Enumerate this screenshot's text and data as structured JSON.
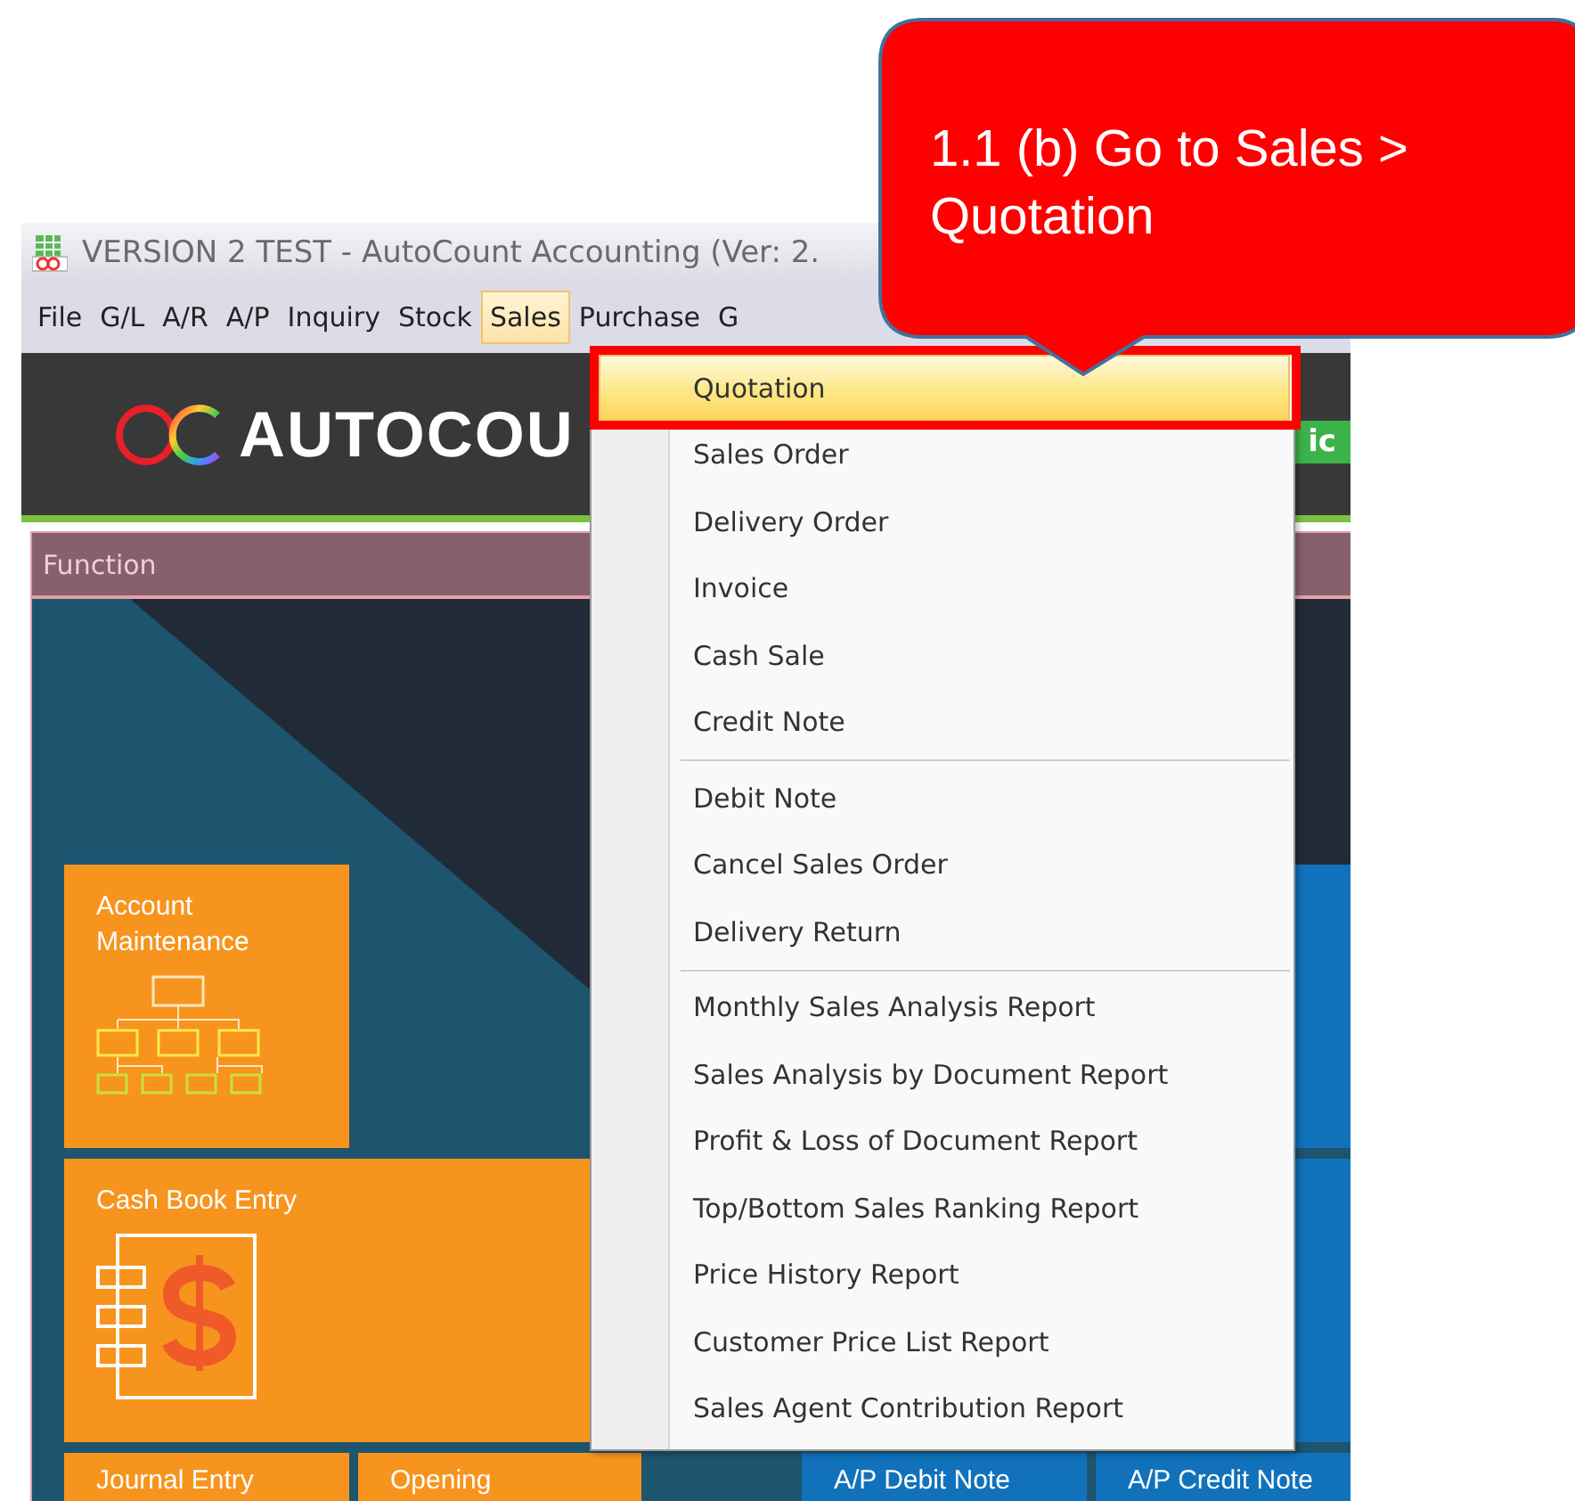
{
  "window": {
    "title": "VERSION 2 TEST - AutoCount Accounting (Ver: 2."
  },
  "menu_bar": [
    {
      "label": "File",
      "selected": false
    },
    {
      "label": "G/L",
      "selected": false
    },
    {
      "label": "A/R",
      "selected": false
    },
    {
      "label": "A/P",
      "selected": false
    },
    {
      "label": "Inquiry",
      "selected": false
    },
    {
      "label": "Stock",
      "selected": false
    },
    {
      "label": "Sales",
      "selected": true
    },
    {
      "label": "Purchase",
      "selected": false
    },
    {
      "label": "G",
      "selected": false
    }
  ],
  "banner": {
    "logo_text": "AUTOCOU",
    "badge": "ic"
  },
  "panel": {
    "title": "Function"
  },
  "tile_rows": [
    [
      {
        "label": "Account Maintenance",
        "kind": "orange"
      },
      {
        "kind": "blue"
      }
    ],
    [
      {
        "label": "Cash Book Entry",
        "kind": "orange"
      },
      {
        "kind": "blue"
      }
    ],
    [
      {
        "label": "Journal Entry",
        "kind": "orange"
      },
      {
        "label": "Opening",
        "kind": "orange"
      },
      {
        "label": "A/P Debit Note",
        "kind": "blue"
      },
      {
        "label": "A/P Credit Note",
        "kind": "blue"
      }
    ]
  ],
  "dropdown": {
    "groups": [
      {
        "items": [
          {
            "label": "Quotation",
            "selected": true,
            "highlighted": true
          },
          {
            "label": "Sales Order",
            "selected": false,
            "highlighted": false
          },
          {
            "label": "Delivery Order",
            "selected": false,
            "highlighted": false
          },
          {
            "label": "Invoice",
            "selected": false,
            "highlighted": false
          },
          {
            "label": "Cash Sale",
            "selected": false,
            "highlighted": false
          },
          {
            "label": "Credit Note",
            "selected": false,
            "highlighted": false
          }
        ]
      },
      {
        "items": [
          {
            "label": "Debit Note",
            "selected": false,
            "highlighted": false
          },
          {
            "label": "Cancel Sales Order",
            "selected": false,
            "highlighted": false
          },
          {
            "label": "Delivery Return",
            "selected": false,
            "highlighted": false
          }
        ]
      },
      {
        "items": [
          {
            "label": "Monthly Sales Analysis Report",
            "selected": false,
            "highlighted": false
          },
          {
            "label": "Sales Analysis by Document Report",
            "selected": false,
            "highlighted": false
          },
          {
            "label": "Profit & Loss of Document Report",
            "selected": false,
            "highlighted": false
          },
          {
            "label": "Top/Bottom Sales Ranking Report",
            "selected": false,
            "highlighted": false
          },
          {
            "label": "Price History Report",
            "selected": false,
            "highlighted": false
          },
          {
            "label": "Customer Price List Report",
            "selected": false,
            "highlighted": false
          },
          {
            "label": "Sales Agent Contribution Report",
            "selected": false,
            "highlighted": false
          }
        ]
      }
    ]
  },
  "callout": {
    "text": "1.1 (b) Go to Sales > Quotation"
  }
}
